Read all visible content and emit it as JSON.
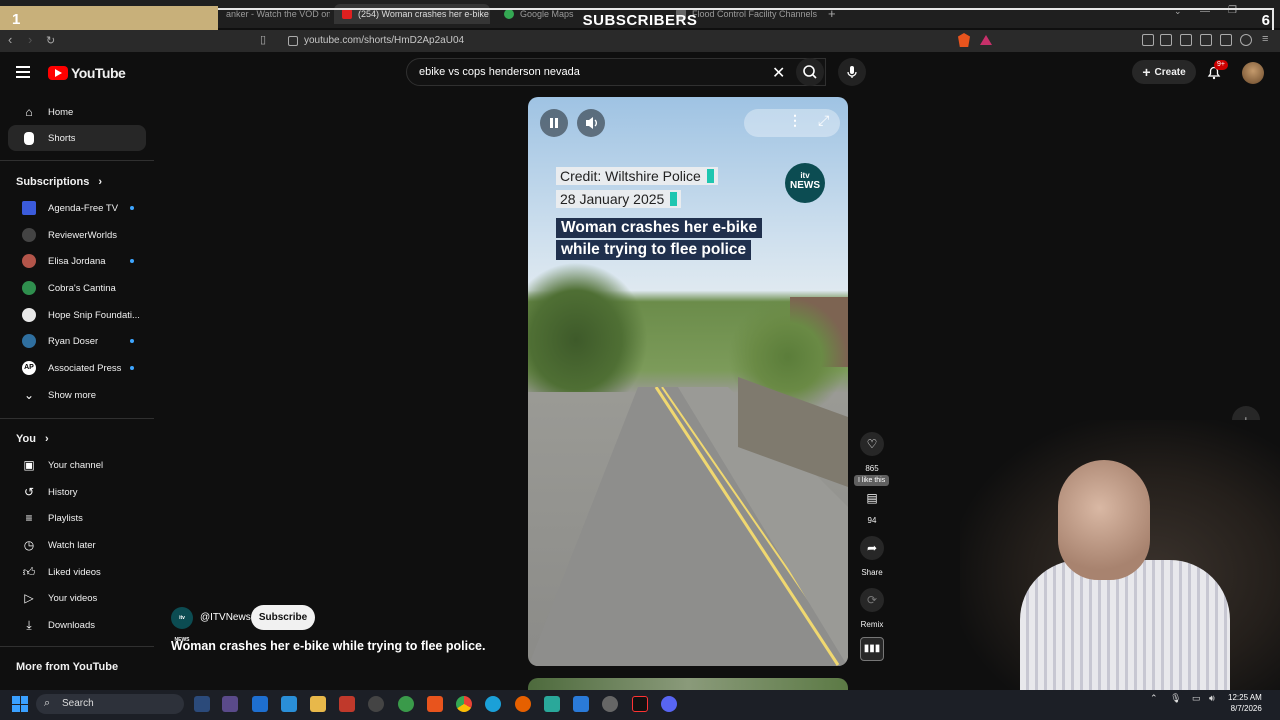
{
  "browser": {
    "tabs": [
      {
        "label": "anker - Watch the VOD on K",
        "active": false
      },
      {
        "label": "(254) Woman crashes her e-bike",
        "active": true
      },
      {
        "label": "Google Maps",
        "active": false
      },
      {
        "label": "Flood Control Facility Channels | Cla",
        "active": false
      }
    ],
    "url": "youtube.com/shorts/HmD2Ap2aU04"
  },
  "stream_overlay": {
    "left_number": "1",
    "title": "SUBSCRIBERS",
    "right_number": "6"
  },
  "youtube": {
    "logo_text": "YouTube",
    "search_value": "ebike vs cops henderson nevada",
    "create_label": "Create",
    "notification_count": "9+"
  },
  "sidebar": {
    "main": [
      {
        "label": "Home",
        "icon": "home-icon"
      },
      {
        "label": "Shorts",
        "icon": "shorts-icon",
        "selected": true
      }
    ],
    "subscriptions_heading": "Subscriptions",
    "subscriptions": [
      {
        "label": "Agenda-Free TV",
        "live": true,
        "color": "#3b5bdb"
      },
      {
        "label": "ReviewerWorlds",
        "live": false,
        "color": "#444444"
      },
      {
        "label": "Elisa Jordana",
        "live": true,
        "color": "#b3554a"
      },
      {
        "label": "Cobra's Cantina",
        "live": false,
        "color": "#2f8f4e"
      },
      {
        "label": "Hope Snip Foundati...",
        "live": false,
        "color": "#e8e8e8"
      },
      {
        "label": "Ryan Doser",
        "live": true,
        "color": "#2f6f9f"
      },
      {
        "label": "Associated Press",
        "live": true,
        "color": "#ffffff",
        "initials": "AP"
      }
    ],
    "show_more": "Show more",
    "you_heading": "You",
    "you_items": [
      {
        "label": "Your channel",
        "icon": "channel-icon"
      },
      {
        "label": "History",
        "icon": "history-icon"
      },
      {
        "label": "Playlists",
        "icon": "playlists-icon"
      },
      {
        "label": "Watch later",
        "icon": "watch-later-icon"
      },
      {
        "label": "Liked videos",
        "icon": "like-icon"
      },
      {
        "label": "Your videos",
        "icon": "video-icon"
      },
      {
        "label": "Downloads",
        "icon": "download-icon"
      }
    ],
    "more_heading": "More from YouTube"
  },
  "short": {
    "credit_line": "Credit: Wiltshire Police",
    "date_line": "28 January 2025",
    "headline_1": "Woman crashes her e-bike",
    "headline_2": "while trying to flee police",
    "logo_top": "itv",
    "logo_bottom": "NEWS",
    "channel_handle": "@ITVNews",
    "channel_avatar_text": "itv NEWS",
    "subscribe_label": "Subscribe",
    "title": "Woman crashes her e-bike while trying to flee police."
  },
  "actions": {
    "likes": "865",
    "like_tooltip": "I like this",
    "comments": "94",
    "share_label": "Share",
    "remix_label": "Remix"
  },
  "taskbar": {
    "search_label": "Search",
    "time": "12:25 AM",
    "date": "8/7/2026"
  }
}
